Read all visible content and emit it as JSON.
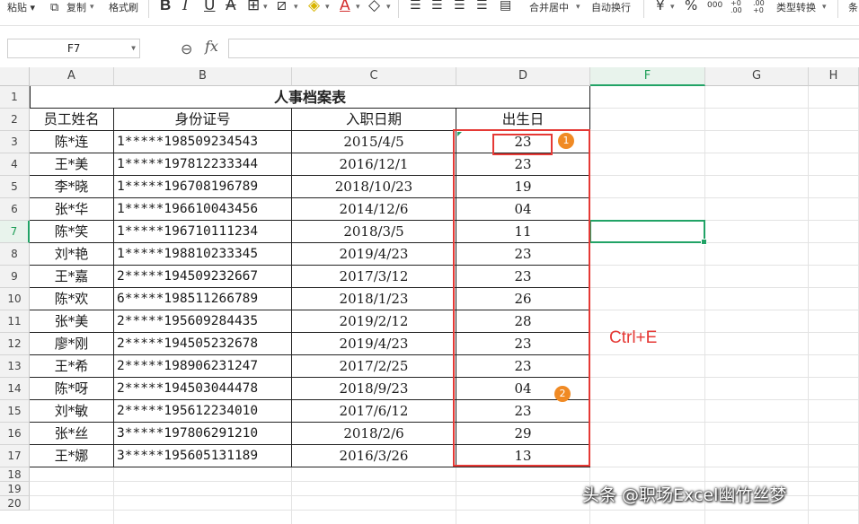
{
  "toolbar": {
    "paste": "粘贴",
    "copy": "复制",
    "format_painter": "格式刷",
    "bold": "B",
    "italic": "I",
    "underline": "U",
    "strike": "A",
    "merge_center": "合并居中",
    "wrap_text": "自动换行",
    "currency": "¥",
    "percent": "%",
    "thousands": "000",
    "dec_increase": "+0 .00",
    "dec_decrease": ".00 +0",
    "type_convert": "类型转换",
    "cond": "条"
  },
  "formula_bar": {
    "cell_ref": "F7",
    "fx": "fx",
    "value": ""
  },
  "columns": [
    "A",
    "B",
    "C",
    "D",
    "F",
    "G",
    "H"
  ],
  "rows": [
    "1",
    "2",
    "3",
    "4",
    "5",
    "6",
    "7",
    "8",
    "9",
    "10",
    "11",
    "12",
    "13",
    "14",
    "15",
    "16",
    "17",
    "18",
    "19",
    "20"
  ],
  "sheet": {
    "title": "人事档案表",
    "headers": [
      "员工姓名",
      "身份证号",
      "入职日期",
      "出生日"
    ],
    "records": [
      [
        "陈*连",
        "1*****198509234543",
        "2015/4/5",
        "23"
      ],
      [
        "王*美",
        "1*****197812233344",
        "2016/12/1",
        "23"
      ],
      [
        "李*晓",
        "1*****196708196789",
        "2018/10/23",
        "19"
      ],
      [
        "张*华",
        "1*****196610043456",
        "2014/12/6",
        "04"
      ],
      [
        "陈*笑",
        "1*****196710111234",
        "2018/3/5",
        "11"
      ],
      [
        "刘*艳",
        "1*****198810233345",
        "2019/4/23",
        "23"
      ],
      [
        "王*嘉",
        "2*****194509232667",
        "2017/3/12",
        "23"
      ],
      [
        "陈*欢",
        "6*****198511266789",
        "2018/1/23",
        "26"
      ],
      [
        "张*美",
        "2*****195609284435",
        "2019/2/12",
        "28"
      ],
      [
        "廖*刚",
        "2*****194505232678",
        "2019/4/23",
        "23"
      ],
      [
        "王*希",
        "2*****198906231247",
        "2017/2/25",
        "23"
      ],
      [
        "陈*呀",
        "2*****194503044478",
        "2018/9/23",
        "04"
      ],
      [
        "刘*敏",
        "2*****195612234010",
        "2017/6/12",
        "23"
      ],
      [
        "张*丝",
        "3*****197806291210",
        "2018/2/6",
        "29"
      ],
      [
        "王*娜",
        "3*****195605131189",
        "2016/3/26",
        "13"
      ]
    ]
  },
  "annotations": {
    "badge1": "1",
    "badge2": "2",
    "shortcut": "Ctrl+E"
  },
  "watermark": "头条 @职场Excel幽竹丝梦",
  "colors": {
    "accent_green": "#21a366",
    "annotation_red": "#e53935",
    "badge_orange": "#f08a24"
  }
}
